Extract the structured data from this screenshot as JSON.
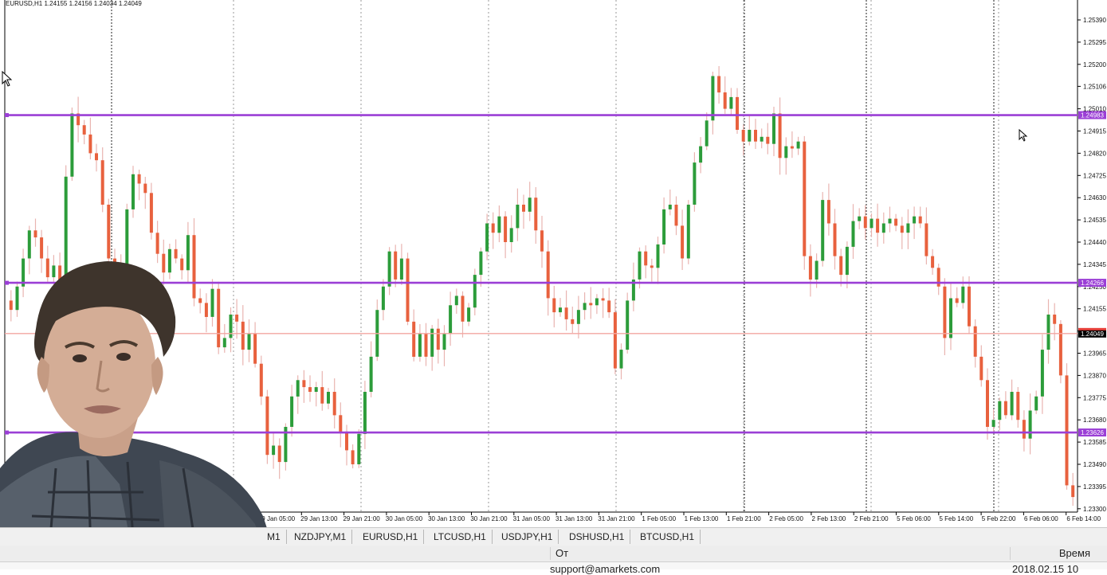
{
  "window": {
    "symbol_title": "EURUSD,H1  1.24155 1.24156 1.24034 1.24049"
  },
  "chart_data": {
    "type": "candlestick",
    "symbol": "EURUSD",
    "timeframe": "H1",
    "ohlc_header": {
      "open": 1.24155,
      "high": 1.24156,
      "low": 1.24034,
      "close": 1.24049
    },
    "ylim": [
      1.2325,
      1.2545
    ],
    "y_ticks": [
      "1.25390",
      "1.25295",
      "1.25200",
      "1.25106",
      "1.25010",
      "1.24915",
      "1.24820",
      "1.24725",
      "1.24630",
      "1.24535",
      "1.24440",
      "1.24345",
      "1.24250",
      "1.24155",
      "1.24060",
      "1.23965",
      "1.23870",
      "1.23775",
      "1.23680",
      "1.23585",
      "1.23490",
      "1.23395",
      "1.23300"
    ],
    "x_tick_labels": [
      "29 Jan 05:00",
      "29 Jan 13:00",
      "29 Jan 21:00",
      "30 Jan 05:00",
      "30 Jan 13:00",
      "30 Jan 21:00",
      "31 Jan 05:00",
      "31 Jan 13:00",
      "31 Jan 21:00",
      "1 Feb 05:00",
      "1 Feb 13:00",
      "1 Feb 21:00",
      "2 Feb 05:00",
      "2 Feb 13:00",
      "2 Feb 21:00",
      "5 Feb 06:00",
      "5 Feb 14:00",
      "5 Feb 22:00",
      "6 Feb 06:00",
      "6 Feb 14:00"
    ],
    "price_levels": [
      {
        "label": "1.24983",
        "value": 1.24983,
        "color": "#9b3fd6"
      },
      {
        "label": "1.24266",
        "value": 1.24266,
        "color": "#9b3fd6"
      },
      {
        "label": "1.23626",
        "value": 1.23626,
        "color": "#9b3fd6"
      }
    ],
    "current_price": {
      "label": "1.24049",
      "value": 1.24049,
      "color": "#e8413a"
    },
    "up_color": "#2c9c3a",
    "down_color": "#e8613e",
    "wick_color": "#e9b4b0",
    "close_path": [
      1.2415,
      1.2425,
      1.2437,
      1.2449,
      1.2446,
      1.2437,
      1.2429,
      1.2434,
      1.2424,
      1.2472,
      1.2499,
      1.2494,
      1.249,
      1.2482,
      1.2479,
      1.246,
      1.2437,
      1.2425,
      1.2434,
      1.2458,
      1.2473,
      1.2469,
      1.2465,
      1.2448,
      1.2439,
      1.2431,
      1.2441,
      1.2437,
      1.2432,
      1.2447,
      1.242,
      1.2418,
      1.2412,
      1.2424,
      1.2399,
      1.2403,
      1.2413,
      1.241,
      1.2398,
      1.2405,
      1.2392,
      1.2378,
      1.2353,
      1.2357,
      1.235,
      1.2365,
      1.2378,
      1.2385,
      1.2382,
      1.238,
      1.2382,
      1.2375,
      1.238,
      1.237,
      1.2363,
      1.2355,
      1.2349,
      1.2362,
      1.238,
      1.2395,
      1.2415,
      1.2425,
      1.244,
      1.2428,
      1.2437,
      1.241,
      1.2395,
      1.2405,
      1.2395,
      1.2407,
      1.2398,
      1.2405,
      1.2417,
      1.2421,
      1.241,
      1.2416,
      1.243,
      1.244,
      1.2452,
      1.2448,
      1.2455,
      1.2444,
      1.245,
      1.246,
      1.2457,
      1.2463,
      1.2449,
      1.244,
      1.242,
      1.2414,
      1.2416,
      1.2411,
      1.2409,
      1.2415,
      1.2418,
      1.2417,
      1.242,
      1.2419,
      1.2414,
      1.239,
      1.2398,
      1.2419,
      1.2428,
      1.244,
      1.2434,
      1.2433,
      1.2443,
      1.2458,
      1.246,
      1.2451,
      1.2437,
      1.246,
      1.2478,
      1.2485,
      1.2496,
      1.2515,
      1.2508,
      1.2501,
      1.2506,
      1.2492,
      1.2487,
      1.2492,
      1.2487,
      1.2489,
      1.2486,
      1.2499,
      1.248,
      1.2485,
      1.2484,
      1.2487,
      1.2438,
      1.2428,
      1.2436,
      1.2462,
      1.2452,
      1.2438,
      1.243,
      1.2442,
      1.2453,
      1.2455,
      1.245,
      1.2454,
      1.2448,
      1.2452,
      1.2454,
      1.2451,
      1.2448,
      1.2452,
      1.2455,
      1.2452,
      1.2438,
      1.2433,
      1.2425,
      1.2403,
      1.242,
      1.2418,
      1.2425,
      1.2408,
      1.2395,
      1.2385,
      1.2365,
      1.2368,
      1.2376,
      1.237,
      1.238,
      1.2368,
      1.236,
      1.2372,
      1.2378,
      1.2398,
      1.2413,
      1.2409,
      1.2387,
      1.234,
      1.2335
    ]
  },
  "symbol_tabs": [
    "M1",
    "NZDJPY,M1",
    "EURUSD,H1",
    "LTCUSD,H1",
    "USDJPY,H1",
    "DSHUSD,H1",
    "BTCUSD,H1"
  ],
  "terminal": {
    "col_from": "От",
    "col_time": "Время",
    "row_from": "support@amarkets.com",
    "row_time": "2018.02.15 10"
  }
}
